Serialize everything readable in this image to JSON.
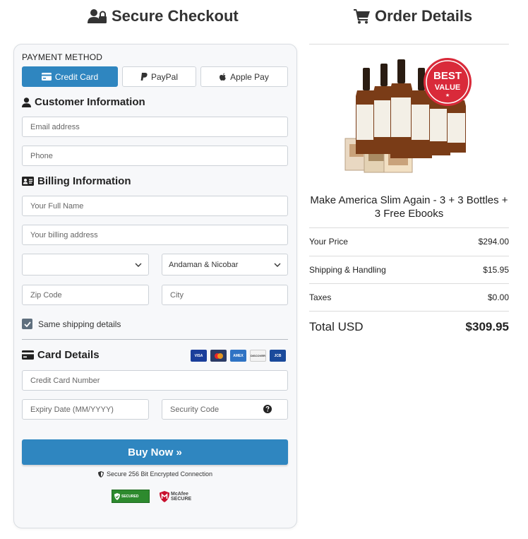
{
  "header": {
    "secure_title": "Secure Checkout",
    "order_title": "Order Details"
  },
  "payment": {
    "label": "PAYMENT METHOD",
    "methods": [
      {
        "label": "Credit Card",
        "icon": "credit-card-icon",
        "active": true
      },
      {
        "label": "PayPal",
        "icon": "paypal-icon",
        "active": false
      },
      {
        "label": "Apple Pay",
        "icon": "apple-icon",
        "active": false
      }
    ]
  },
  "customer": {
    "title": "Customer Information",
    "email_placeholder": "Email address",
    "phone_placeholder": "Phone"
  },
  "billing": {
    "title": "Billing Information",
    "name_placeholder": "Your Full Name",
    "address_placeholder": "Your billing address",
    "country_value": "",
    "state_value": "Andaman & Nicobar",
    "zip_placeholder": "Zip Code",
    "city_placeholder": "City",
    "same_shipping_label": "Same shipping details",
    "same_shipping_checked": true
  },
  "card": {
    "title": "Card Details",
    "logos": [
      "VISA",
      "mastercard",
      "AMEX",
      "DISCOVER",
      "JCB"
    ],
    "number_placeholder": "Credit Card Number",
    "expiry_placeholder": "Expiry Date (MM/YYYY)",
    "cvv_placeholder": "Security Code"
  },
  "actions": {
    "buy_label": "Buy Now »",
    "secure_note": "Secure 256 Bit Encrypted Connection"
  },
  "trust": {
    "secured_badge": "SECURED",
    "mcafee_line1": "McAfee",
    "mcafee_line2": "SECURE"
  },
  "order": {
    "badge_top": "BEST",
    "badge_bottom": "VALUE",
    "product_name": "Make America Slim Again - 3 + 3 Bottles + 3 Free Ebooks",
    "rows": [
      {
        "label": "Your Price",
        "value": "$294.00"
      },
      {
        "label": "Shipping & Handling",
        "value": "$15.95"
      },
      {
        "label": "Taxes",
        "value": "$0.00"
      }
    ],
    "total_label": "Total USD",
    "total_value": "$309.95"
  },
  "colors": {
    "accent": "#2f86c0",
    "badge_red": "#d92a3a"
  }
}
